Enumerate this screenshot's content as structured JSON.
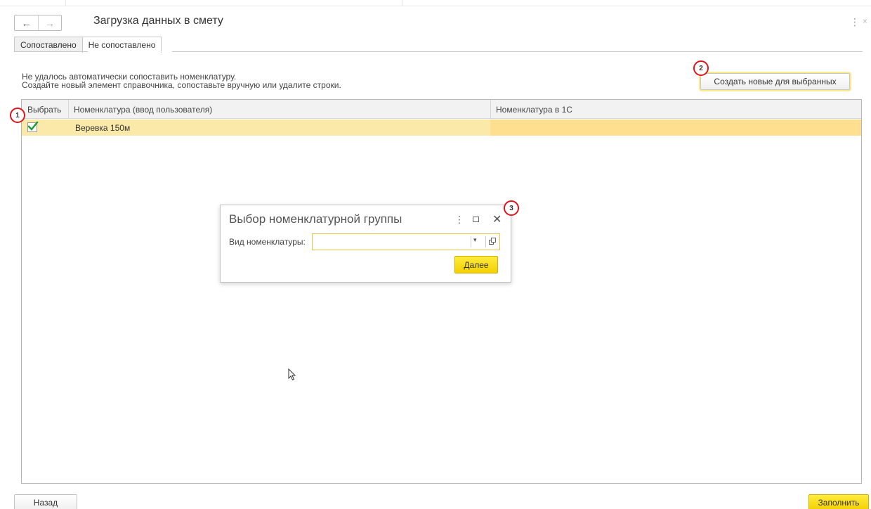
{
  "window": {
    "title": "Загрузка данных в смету",
    "back_arrow": "←",
    "forward_arrow": "→",
    "more_icon": "⋮",
    "close_icon": "×"
  },
  "tabs": [
    {
      "label": "Сопоставлено",
      "active": false
    },
    {
      "label": "Не сопоставлено",
      "active": true
    }
  ],
  "info": {
    "line1": "Не удалось автоматически сопоставить номенклатуру.",
    "line2": "Создайте новый элемент справочника, сопоставьте вручную или удалите строки."
  },
  "create_button": {
    "label": "Создать новые для выбранных"
  },
  "markers": [
    "1",
    "2",
    "3"
  ],
  "table": {
    "columns": [
      "Выбрать",
      "Номенклатура (ввод пользователя)",
      "Номенклатура в 1С"
    ],
    "rows": [
      {
        "selected": true,
        "user_input": "Веревка 150м",
        "item_1c": ""
      }
    ]
  },
  "dialog": {
    "title": "Выбор номенклатурной группы",
    "field_label": "Вид номенклатуры:",
    "field_value": "",
    "next_label": "Далее",
    "dropdown_glyph": "▾",
    "more_icon": "⋮",
    "close_icon": "✕"
  },
  "footer": {
    "back_label": "Назад",
    "fill_label": "Заполнить"
  },
  "colors": {
    "accent_yellow": "#f4d000",
    "row_highlight": "#fbe9a9",
    "marker_red": "#e0141e"
  }
}
